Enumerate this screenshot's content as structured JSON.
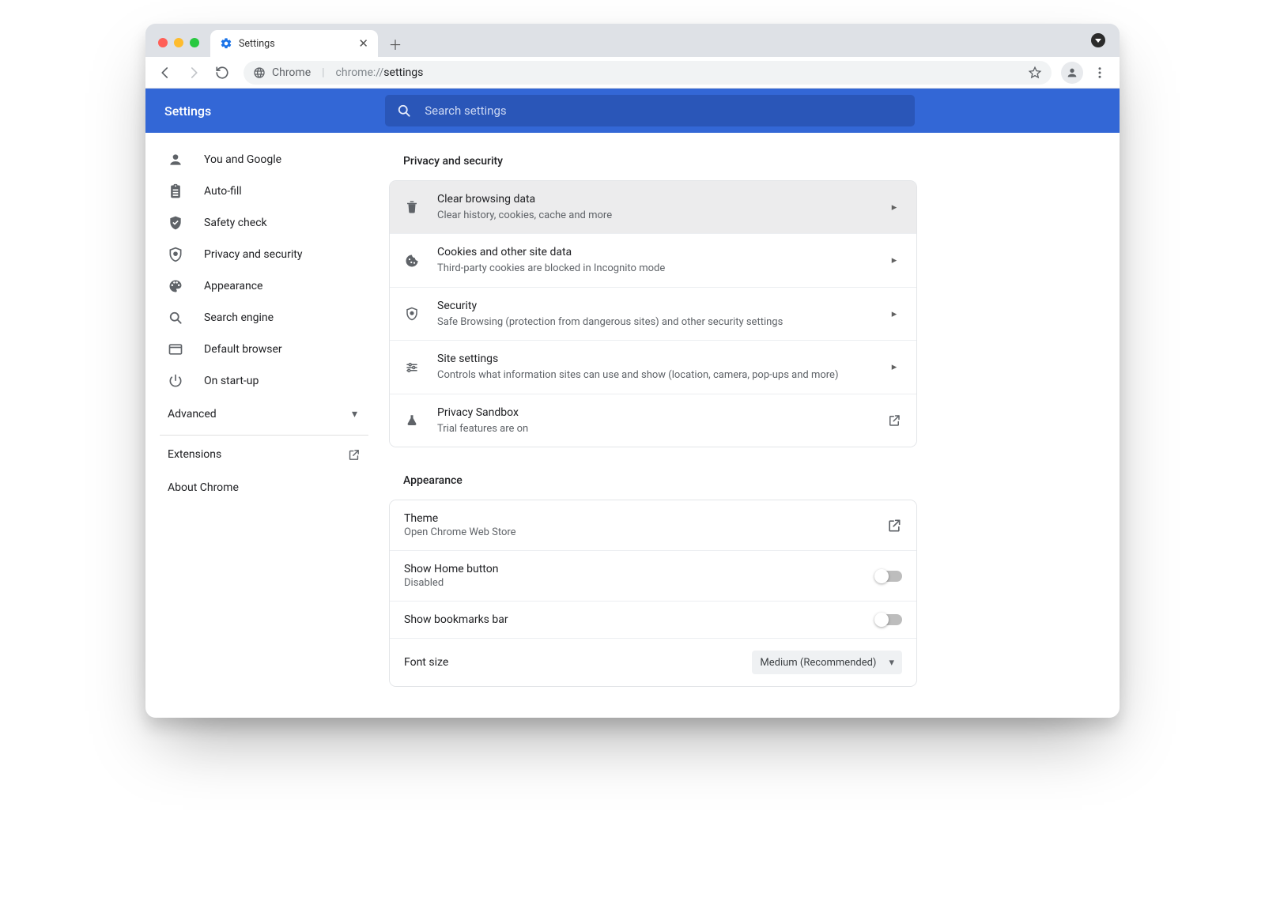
{
  "tab": {
    "title": "Settings"
  },
  "omnibox": {
    "scheme": "Chrome",
    "url_prefix": "chrome://",
    "url_path": "settings"
  },
  "header": {
    "title": "Settings"
  },
  "search": {
    "placeholder": "Search settings"
  },
  "sidebar": {
    "items": [
      {
        "label": "You and Google"
      },
      {
        "label": "Auto-fill"
      },
      {
        "label": "Safety check"
      },
      {
        "label": "Privacy and security"
      },
      {
        "label": "Appearance"
      },
      {
        "label": "Search engine"
      },
      {
        "label": "Default browser"
      },
      {
        "label": "On start-up"
      }
    ],
    "advanced": "Advanced",
    "extensions": "Extensions",
    "about": "About Chrome"
  },
  "sections": {
    "privacy": {
      "title": "Privacy and security",
      "rows": [
        {
          "title": "Clear browsing data",
          "subtitle": "Clear history, cookies, cache and more"
        },
        {
          "title": "Cookies and other site data",
          "subtitle": "Third-party cookies are blocked in Incognito mode"
        },
        {
          "title": "Security",
          "subtitle": "Safe Browsing (protection from dangerous sites) and other security settings"
        },
        {
          "title": "Site settings",
          "subtitle": "Controls what information sites can use and show (location, camera, pop-ups and more)"
        },
        {
          "title": "Privacy Sandbox",
          "subtitle": "Trial features are on"
        }
      ]
    },
    "appearance": {
      "title": "Appearance",
      "theme": {
        "title": "Theme",
        "subtitle": "Open Chrome Web Store"
      },
      "homebtn": {
        "title": "Show Home button",
        "subtitle": "Disabled"
      },
      "bookmarks": {
        "title": "Show bookmarks bar"
      },
      "fontsize": {
        "title": "Font size",
        "value": "Medium (Recommended)"
      }
    }
  }
}
